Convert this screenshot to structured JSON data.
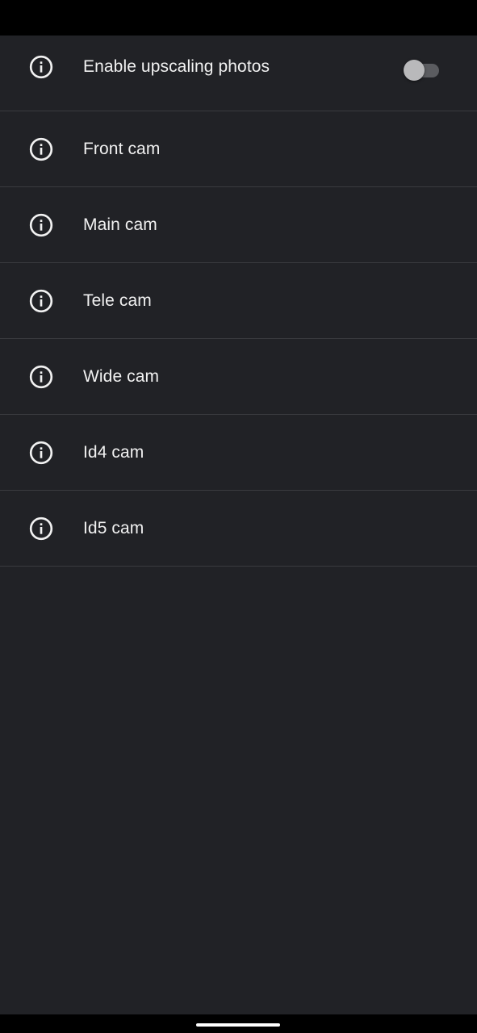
{
  "settings": {
    "items": [
      {
        "label": "Enable upscaling photos",
        "icon": "info-icon",
        "toggle": {
          "checked": false
        }
      },
      {
        "label": "Front cam",
        "icon": "info-icon"
      },
      {
        "label": "Main cam",
        "icon": "info-icon"
      },
      {
        "label": "Tele cam",
        "icon": "info-icon"
      },
      {
        "label": "Wide cam",
        "icon": "info-icon"
      },
      {
        "label": "Id4 cam",
        "icon": "info-icon"
      },
      {
        "label": "Id5 cam",
        "icon": "info-icon"
      }
    ]
  },
  "colors": {
    "background": "#212226",
    "divider": "#3a3b3f",
    "text": "#f1f1f1",
    "toggle_track": "#5b5c60",
    "toggle_thumb": "#b9b9bb"
  }
}
